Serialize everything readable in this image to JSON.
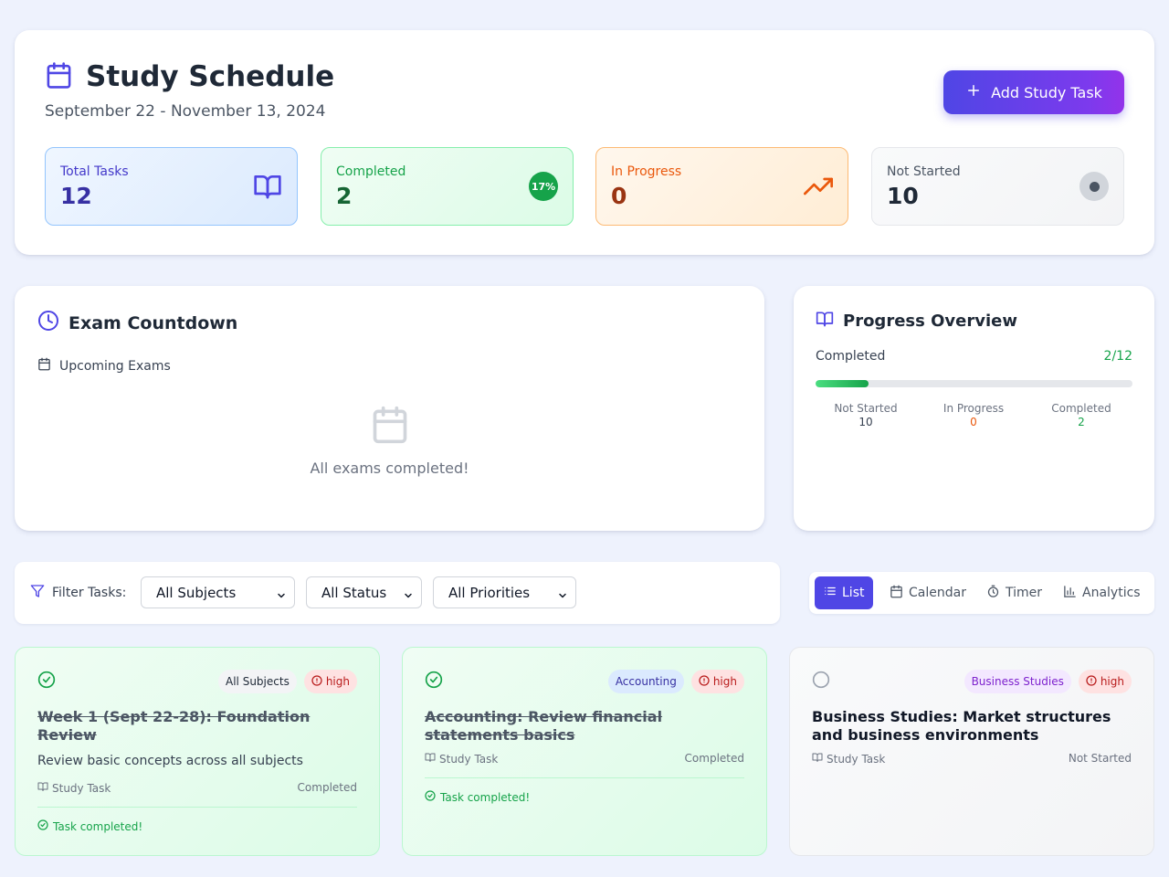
{
  "header": {
    "title": "Study Schedule",
    "date_range": "September 22 - November 13, 2024",
    "add_button_label": "Add Study Task"
  },
  "stats": {
    "total": {
      "label": "Total Tasks",
      "value": "12"
    },
    "completed": {
      "label": "Completed",
      "value": "2",
      "percent_badge": "17%"
    },
    "in_progress": {
      "label": "In Progress",
      "value": "0"
    },
    "not_started": {
      "label": "Not Started",
      "value": "10"
    }
  },
  "exam_countdown": {
    "title": "Exam Countdown",
    "upcoming_label": "Upcoming Exams",
    "empty_message": "All exams completed!"
  },
  "progress_overview": {
    "title": "Progress Overview",
    "completed_label": "Completed",
    "completed_ratio": "2/12",
    "completed_fraction": 0.1667,
    "columns": [
      {
        "label": "Not Started",
        "value": "10",
        "color": "#374151"
      },
      {
        "label": "In Progress",
        "value": "0",
        "color": "#ea580c"
      },
      {
        "label": "Completed",
        "value": "2",
        "color": "#16a34a"
      }
    ]
  },
  "filters": {
    "label": "Filter Tasks:",
    "subject_selected": "All Subjects",
    "status_selected": "All Status",
    "priority_selected": "All Priorities"
  },
  "views": {
    "list": "List",
    "calendar": "Calendar",
    "timer": "Timer",
    "analytics": "Analytics",
    "active": "List"
  },
  "tasks": [
    {
      "subject": "All Subjects",
      "priority": "high",
      "title": "Week 1 (Sept 22-28): Foundation Review",
      "description": "Review basic concepts across all subjects",
      "kind": "Study Task",
      "status": "Completed",
      "completed_message": "Task completed!"
    },
    {
      "subject": "Accounting",
      "priority": "high",
      "title": "Accounting: Review financial statements basics",
      "kind": "Study Task",
      "status": "Completed",
      "completed_message": "Task completed!"
    },
    {
      "subject": "Business Studies",
      "priority": "high",
      "title": "Business Studies: Market structures and business environments",
      "kind": "Study Task",
      "status": "Not Started"
    }
  ],
  "colors": {
    "accent": "#4f46e5",
    "success": "#16a34a",
    "warning": "#ea580c",
    "danger": "#b91c1c",
    "background": "#eef2fd"
  }
}
